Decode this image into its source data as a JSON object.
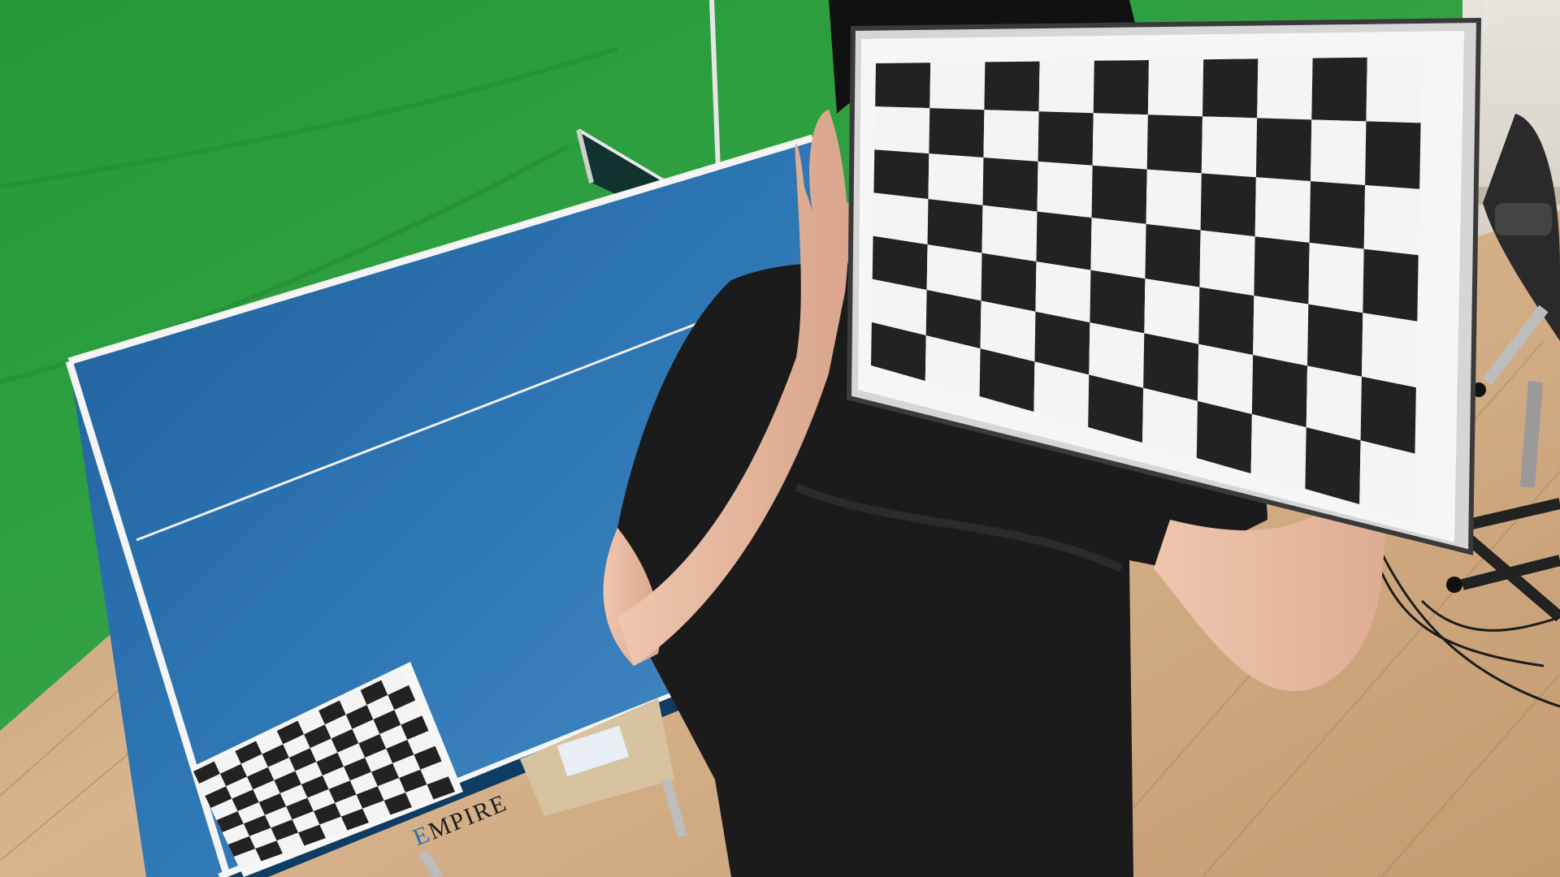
{
  "table": {
    "brand_prefix": "E",
    "brand_rest": "MPIRE"
  },
  "colors": {
    "green_screen": "#2e9c3f",
    "table_blue": "#2a6fab",
    "floor": "#c9a27a",
    "shirt": "#1a1a1a",
    "skin": "#e8b9a0",
    "board_dark": "#222222",
    "board_light": "#f4f4f4"
  },
  "calibration_boards": [
    {
      "name": "handheld-board",
      "rows": 7,
      "cols": 10
    },
    {
      "name": "table-board",
      "rows": 8,
      "cols": 10
    }
  ]
}
